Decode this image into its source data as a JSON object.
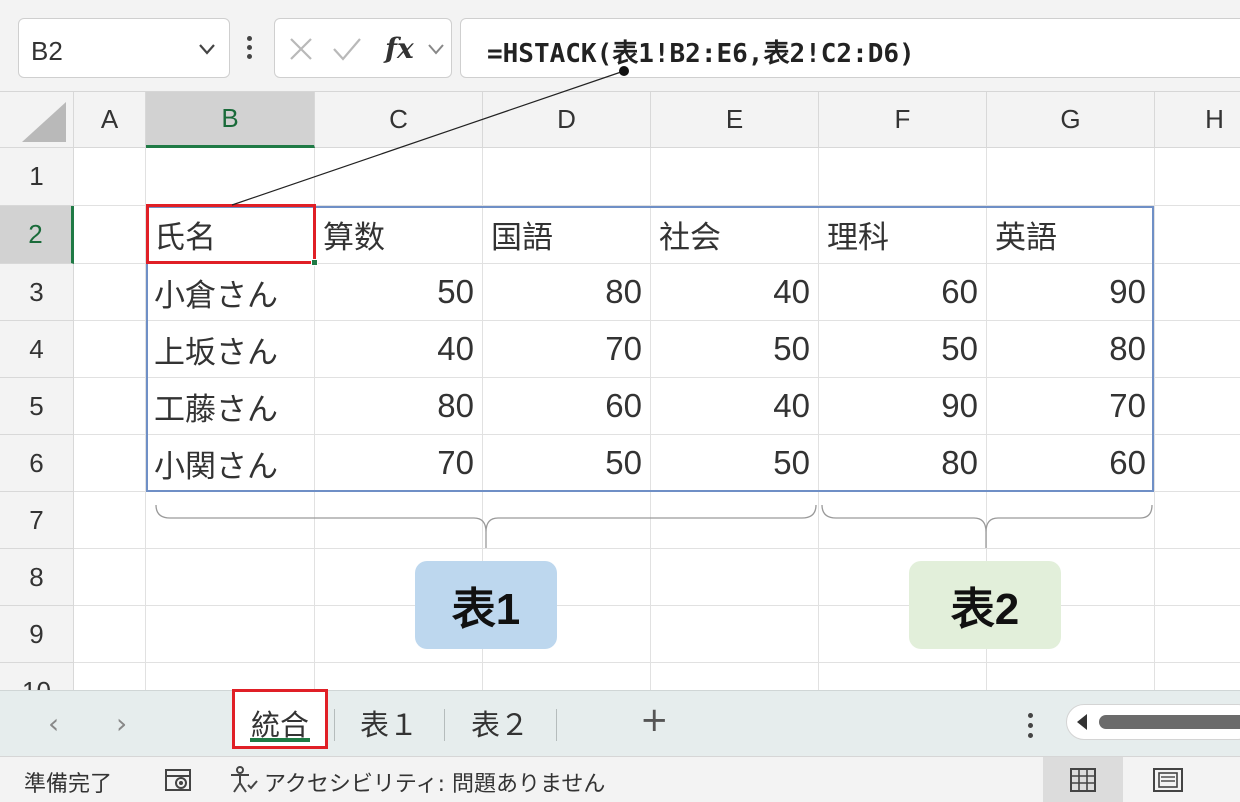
{
  "name_box": {
    "value": "B2"
  },
  "formula_bar": {
    "formula": "=HSTACK(表1!B2:E6,表2!C2:D6)",
    "cancel_icon": "x-icon",
    "enter_icon": "check-icon",
    "function_icon": "fx-icon"
  },
  "grid": {
    "columns": [
      "A",
      "B",
      "C",
      "D",
      "E",
      "F",
      "G",
      "H"
    ],
    "rows": [
      "1",
      "2",
      "3",
      "4",
      "5",
      "6",
      "7",
      "8",
      "9",
      "10"
    ],
    "selected_column": "B",
    "selected_row": "2",
    "header_row": [
      "氏名",
      "算数",
      "国語",
      "社会",
      "理科",
      "英語"
    ],
    "data_rows": [
      {
        "name": "小倉さん",
        "values": [
          "50",
          "80",
          "40",
          "60",
          "90"
        ]
      },
      {
        "name": "上坂さん",
        "values": [
          "40",
          "70",
          "50",
          "50",
          "80"
        ]
      },
      {
        "name": "工藤さん",
        "values": [
          "80",
          "60",
          "40",
          "90",
          "70"
        ]
      },
      {
        "name": "小関さん",
        "values": [
          "70",
          "50",
          "50",
          "80",
          "60"
        ]
      }
    ]
  },
  "annotations": {
    "badge_1": "表1",
    "badge_2": "表2",
    "badge_1_color": "#bdd7ee",
    "badge_2_color": "#e2efda",
    "highlight_color": "#e01f26"
  },
  "sheet_tabs": {
    "tabs": [
      {
        "label": "統合",
        "active": true
      },
      {
        "label": "表１",
        "active": false
      },
      {
        "label": "表２",
        "active": false
      }
    ],
    "add_label": "+"
  },
  "status_bar": {
    "ready": "準備完了",
    "accessibility": "アクセシビリティ: 問題ありません"
  }
}
